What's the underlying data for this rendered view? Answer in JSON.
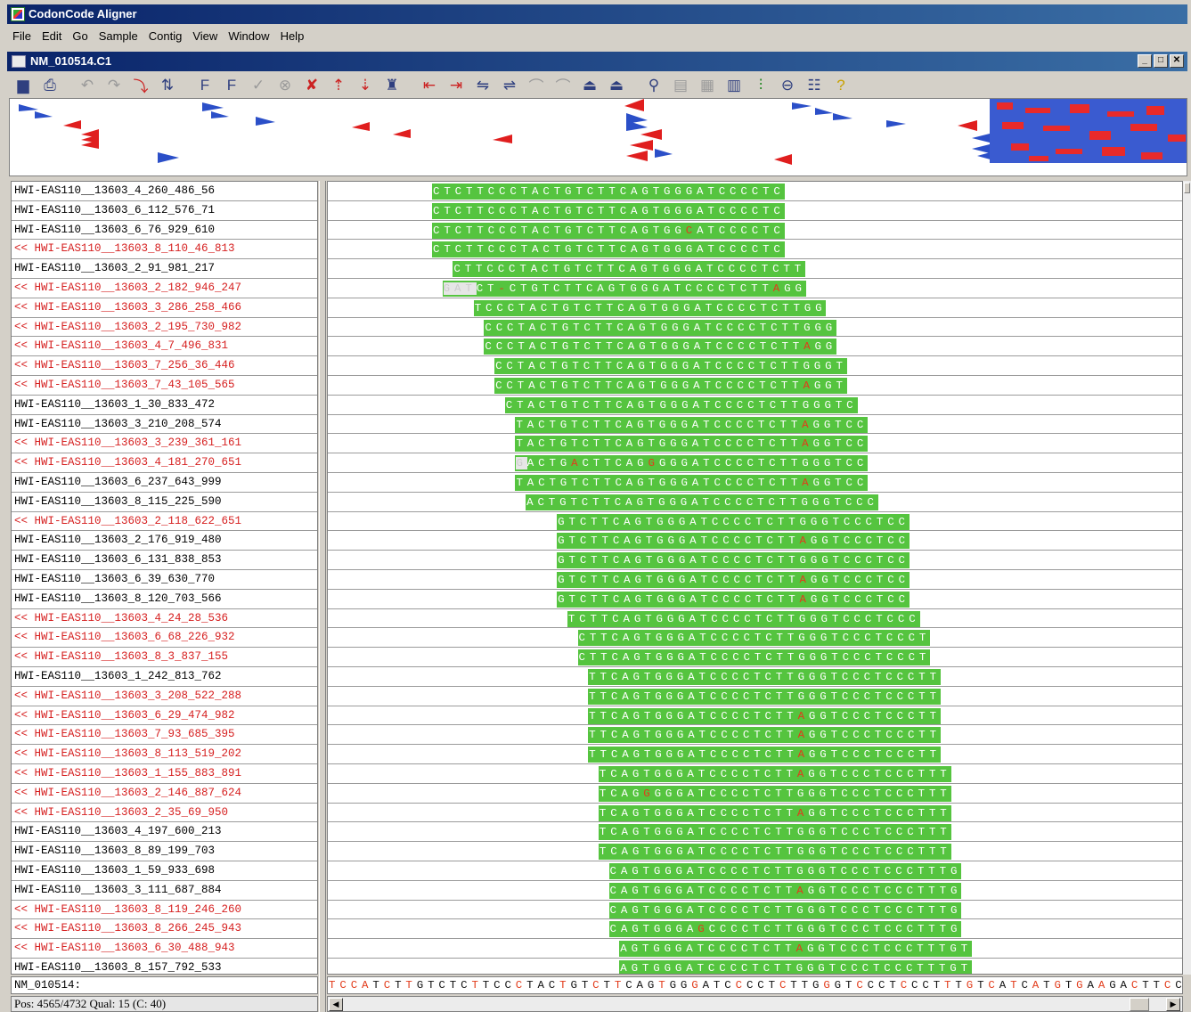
{
  "app": {
    "title": "CodonCode Aligner"
  },
  "menu": [
    "File",
    "Edit",
    "Go",
    "Sample",
    "Contig",
    "View",
    "Window",
    "Help"
  ],
  "document": {
    "title": "NM_010514.C1"
  },
  "toolbar_icons": [
    "save-icon",
    "print-icon",
    "undo-icon",
    "redo-icon",
    "trim-icon",
    "sort-icon",
    "flag-forward-icon",
    "flag-reverse-icon",
    "checkmark-icon",
    "delete-circle-icon",
    "remove-read-icon",
    "move-up-icon",
    "move-down-icon",
    "assemble-icon",
    "insert-gap-left-icon",
    "insert-gap-right-icon",
    "shift-left-icon",
    "shift-right-icon",
    "previous-icon",
    "next-icon",
    "previous-mismatch-icon",
    "next-mismatch-icon",
    "zoom-icon",
    "chromatogram-icon",
    "trace-icon",
    "bar-chart-icon",
    "translate-icon",
    "link-icon",
    "list-icon",
    "help-icon"
  ],
  "reads": [
    {
      "name": "HWI-EAS110__13603_4_260_486_56",
      "rev": false,
      "seq": "CTCTTCCCTACTGTCTTCAGTGGGATCCCCTC",
      "start": 0,
      "pre": "",
      "mm": []
    },
    {
      "name": "HWI-EAS110__13603_6_112_576_71",
      "rev": false,
      "seq": "CTCTTCCCTACTGTCTTCAGTGGGATCCCCTC",
      "start": 0,
      "pre": "",
      "mm": []
    },
    {
      "name": "HWI-EAS110__13603_6_76_929_610",
      "rev": false,
      "seq": "CTCTTCCCTACTGTCTTCAGTGGCATCCCCTC",
      "start": 0,
      "pre": "",
      "mm": [
        23
      ]
    },
    {
      "name": "<< HWI-EAS110__13603_8_110_46_813",
      "rev": true,
      "seq": "CTCTTCCCTACTGTCTTCAGTGGGATCCCCTC",
      "start": 0,
      "pre": "",
      "mm": []
    },
    {
      "name": "HWI-EAS110__13603_2_91_981_217",
      "rev": false,
      "seq": "CTTCCCTACTGTCTTCAGTGGGATCCCCTCTT",
      "start": 2,
      "pre": "",
      "mm": []
    },
    {
      "name": "<< HWI-EAS110__13603_2_182_946_247",
      "rev": true,
      "seq": "CT-CTGTCTTCAGTGGGATCCCCTCTTAGG",
      "start": 4,
      "pre": "GAT",
      "mm": [
        2,
        27
      ]
    },
    {
      "name": "<< HWI-EAS110__13603_3_286_258_466",
      "rev": true,
      "seq": "TCCCTACTGTCTTCAGTGGGATCCCCTCTTGG",
      "start": 4,
      "pre": "",
      "mm": []
    },
    {
      "name": "<< HWI-EAS110__13603_2_195_730_982",
      "rev": true,
      "seq": "CCCTACTGTCTTCAGTGGGATCCCCTCTTGGG",
      "start": 5,
      "pre": "",
      "mm": []
    },
    {
      "name": "<< HWI-EAS110__13603_4_7_496_831",
      "rev": true,
      "seq": "CCCTACTGTCTTCAGTGGGATCCCCTCTTAGG",
      "start": 5,
      "pre": "",
      "mm": [
        29
      ]
    },
    {
      "name": "<< HWI-EAS110__13603_7_256_36_446",
      "rev": true,
      "seq": "CCTACTGTCTTCAGTGGGATCCCCTCTTGGGT",
      "start": 6,
      "pre": "",
      "mm": []
    },
    {
      "name": "<< HWI-EAS110__13603_7_43_105_565",
      "rev": true,
      "seq": "CCTACTGTCTTCAGTGGGATCCCCTCTTAGGT",
      "start": 6,
      "pre": "",
      "mm": [
        28
      ]
    },
    {
      "name": "HWI-EAS110__13603_1_30_833_472",
      "rev": false,
      "seq": "CTACTGTCTTCAGTGGGATCCCCTCTTGGGTC",
      "start": 7,
      "pre": "",
      "mm": []
    },
    {
      "name": "HWI-EAS110__13603_3_210_208_574",
      "rev": false,
      "seq": "TACTGTCTTCAGTGGGATCCCCTCTTAGGTCC",
      "start": 8,
      "pre": "",
      "mm": [
        26
      ]
    },
    {
      "name": "<< HWI-EAS110__13603_3_239_361_161",
      "rev": true,
      "seq": "TACTGTCTTCAGTGGGATCCCCTCTTAGGTCC",
      "start": 8,
      "pre": "",
      "mm": [
        26
      ]
    },
    {
      "name": "<< HWI-EAS110__13603_4_181_270_651",
      "rev": true,
      "seq": "ACTGACTTCAGGGGGATCCCCTCTTGGGTCC",
      "start": 9,
      "pre": "G",
      "mm": [
        4,
        11
      ]
    },
    {
      "name": "HWI-EAS110__13603_6_237_643_999",
      "rev": false,
      "seq": "TACTGTCTTCAGTGGGATCCCCTCTTAGGTCC",
      "start": 8,
      "pre": "",
      "mm": [
        26
      ]
    },
    {
      "name": "HWI-EAS110__13603_8_115_225_590",
      "rev": false,
      "seq": "ACTGTCTTCAGTGGGATCCCCTCTTGGGTCCC",
      "start": 9,
      "pre": "",
      "mm": []
    },
    {
      "name": "<< HWI-EAS110__13603_2_118_622_651",
      "rev": true,
      "seq": "GTCTTCAGTGGGATCCCCTCTTGGGTCCCTCC",
      "start": 12,
      "pre": "",
      "mm": []
    },
    {
      "name": "HWI-EAS110__13603_2_176_919_480",
      "rev": false,
      "seq": "GTCTTCAGTGGGATCCCCTCTTAGGTCCCTCC",
      "start": 12,
      "pre": "",
      "mm": [
        22
      ]
    },
    {
      "name": "HWI-EAS110__13603_6_131_838_853",
      "rev": false,
      "seq": "GTCTTCAGTGGGATCCCCTCTTGGGTCCCTCC",
      "start": 12,
      "pre": "",
      "mm": []
    },
    {
      "name": "HWI-EAS110__13603_6_39_630_770",
      "rev": false,
      "seq": "GTCTTCAGTGGGATCCCCTCTTAGGTCCCTCC",
      "start": 12,
      "pre": "",
      "mm": [
        22
      ]
    },
    {
      "name": "HWI-EAS110__13603_8_120_703_566",
      "rev": false,
      "seq": "GTCTTCAGTGGGATCCCCTCTTAGGTCCCTCC",
      "start": 12,
      "pre": "",
      "mm": [
        22
      ]
    },
    {
      "name": "<< HWI-EAS110__13603_4_24_28_536",
      "rev": true,
      "seq": "TCTTCAGTGGGATCCCCTCTTGGGTCCCTCCC",
      "start": 13,
      "pre": "",
      "mm": []
    },
    {
      "name": "<< HWI-EAS110__13603_6_68_226_932",
      "rev": true,
      "seq": "CTTCAGTGGGATCCCCTCTTGGGTCCCTCCCT",
      "start": 14,
      "pre": "",
      "mm": []
    },
    {
      "name": "<< HWI-EAS110__13603_8_3_837_155",
      "rev": true,
      "seq": "CTTCAGTGGGATCCCCTCTTGGGTCCCTCCCT",
      "start": 14,
      "pre": "",
      "mm": []
    },
    {
      "name": "HWI-EAS110__13603_1_242_813_762",
      "rev": false,
      "seq": "TTCAGTGGGATCCCCTCTTGGGTCCCTCCCTT",
      "start": 15,
      "pre": "",
      "mm": []
    },
    {
      "name": "<< HWI-EAS110__13603_3_208_522_288",
      "rev": true,
      "seq": "TTCAGTGGGATCCCCTCTTGGGTCCCTCCCTT",
      "start": 15,
      "pre": "",
      "mm": []
    },
    {
      "name": "<< HWI-EAS110__13603_6_29_474_982",
      "rev": true,
      "seq": "TTCAGTGGGATCCCCTCTTAGGTCCCTCCCTT",
      "start": 15,
      "pre": "",
      "mm": [
        19
      ]
    },
    {
      "name": "<< HWI-EAS110__13603_7_93_685_395",
      "rev": true,
      "seq": "TTCAGTGGGATCCCCTCTTAGGTCCCTCCCTT",
      "start": 15,
      "pre": "",
      "mm": [
        19
      ]
    },
    {
      "name": "<< HWI-EAS110__13603_8_113_519_202",
      "rev": true,
      "seq": "TTCAGTGGGATCCCCTCTTAGGTCCCTCCCTT",
      "start": 15,
      "pre": "",
      "mm": [
        19
      ]
    },
    {
      "name": "<< HWI-EAS110__13603_1_155_883_891",
      "rev": true,
      "seq": "TCAGTGGGATCCCCTCTTAGGTCCCTCCCTTT",
      "start": 16,
      "pre": "",
      "mm": [
        18
      ]
    },
    {
      "name": "<< HWI-EAS110__13603_2_146_887_624",
      "rev": true,
      "seq": "TCAGGGGGATCCCCTCTTGGGTCCCTCCCTTT",
      "start": 16,
      "pre": "",
      "mm": [
        4
      ]
    },
    {
      "name": "<< HWI-EAS110__13603_2_35_69_950",
      "rev": true,
      "seq": "TCAGTGGGATCCCCTCTTAGGTCCCTCCCTTT",
      "start": 16,
      "pre": "",
      "mm": [
        18
      ]
    },
    {
      "name": "HWI-EAS110__13603_4_197_600_213",
      "rev": false,
      "seq": "TCAGTGGGATCCCCTCTTGGGTCCCTCCCTTT",
      "start": 16,
      "pre": "",
      "mm": []
    },
    {
      "name": "HWI-EAS110__13603_8_89_199_703",
      "rev": false,
      "seq": "TCAGTGGGATCCCCTCTTGGGTCCCTCCCTTT",
      "start": 16,
      "pre": "",
      "mm": []
    },
    {
      "name": "HWI-EAS110__13603_1_59_933_698",
      "rev": false,
      "seq": "CAGTGGGATCCCCTCTTGGGTCCCTCCCTTTG",
      "start": 17,
      "pre": "",
      "mm": []
    },
    {
      "name": "HWI-EAS110__13603_3_111_687_884",
      "rev": false,
      "seq": "CAGTGGGATCCCCTCTTAGGTCCCTCCCTTTG",
      "start": 17,
      "pre": "",
      "mm": [
        17
      ]
    },
    {
      "name": "<< HWI-EAS110__13603_8_119_246_260",
      "rev": true,
      "seq": "CAGTGGGATCCCCTCTTGGGTCCCTCCCTTTG",
      "start": 17,
      "pre": "",
      "mm": []
    },
    {
      "name": "<< HWI-EAS110__13603_8_266_245_943",
      "rev": true,
      "seq": "CAGTGGGAGCCCCTCTTGGGTCCCTCCCTTTG",
      "start": 17,
      "pre": "",
      "mm": [
        8
      ]
    },
    {
      "name": "<< HWI-EAS110__13603_6_30_488_943",
      "rev": true,
      "seq": "AGTGGGATCCCCTCTTAGGTCCCTCCCTTTGT",
      "start": 18,
      "pre": "",
      "mm": [
        16
      ]
    },
    {
      "name": "HWI-EAS110__13603_8_157_792_533",
      "rev": false,
      "seq": "AGTGGGATCCCCTCTTGGGTCCCTCCCTTTGT",
      "start": 18,
      "pre": "",
      "mm": []
    }
  ],
  "consensus": {
    "name": "NM_010514:",
    "seq": "TCCATCTTGTCTCTTCCCTACTGTCTTCAGTGGGATCCCCTCTTGGGTCCCTCCCTTTGTCATCATGTGAAGACTTCCCACG",
    "red_positions": [
      0,
      1,
      2,
      3,
      5,
      7,
      13,
      17,
      21,
      24,
      26,
      30,
      33,
      37,
      41,
      45,
      48,
      52,
      56,
      58,
      60,
      62,
      64,
      66,
      68,
      70,
      73,
      76,
      79,
      81
    ]
  },
  "status": {
    "text": "Pos: 4565/4732  Qual: 15 (C: 40)"
  }
}
